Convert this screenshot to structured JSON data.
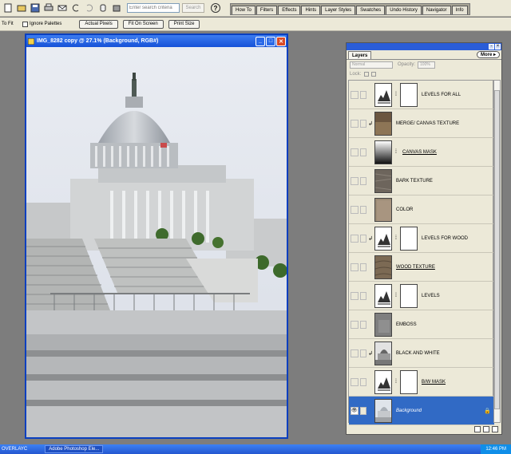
{
  "toolbar": {
    "search_placeholder": "Enter search criteria",
    "search_button": "Search",
    "help": "?"
  },
  "palette_well": {
    "tabs": [
      "How To",
      "Filters",
      "Effects",
      "Hints",
      "Layer Styles",
      "Swatches",
      "Undo History",
      "Navigator",
      "Info"
    ]
  },
  "options_bar": {
    "to_fit": "To Fit",
    "ignore_palettes": "Ignore Palettes",
    "actual_pixels": "Actual Pixels",
    "fit_on_screen": "Fit On Screen",
    "print_size": "Print Size"
  },
  "document": {
    "title": "IMG_8282 copy @ 27.1% (Background, RGB#)"
  },
  "layers_panel": {
    "tab_label": "Layers",
    "more_label": "More",
    "blend_mode": "Normal",
    "opacity_label": "Opacity:",
    "opacity_value": "100%",
    "lock_label": "Lock:",
    "layers": [
      {
        "name": "LEVELS FOR ALL",
        "type": "adjustment",
        "clipped": false,
        "underline": false,
        "selected": false
      },
      {
        "name": "MERGE/ CANVAS TEXTURE",
        "type": "image",
        "clipped": true,
        "underline": false,
        "selected": false
      },
      {
        "name": "CANVAS MASK",
        "type": "gradient-mask",
        "clipped": false,
        "underline": true,
        "selected": false
      },
      {
        "name": "BARK TEXTURE",
        "type": "texture",
        "clipped": false,
        "underline": false,
        "selected": false
      },
      {
        "name": "COLOR",
        "type": "color",
        "clipped": false,
        "underline": false,
        "selected": false
      },
      {
        "name": "LEVELS FOR WOOD",
        "type": "adjustment",
        "clipped": true,
        "underline": false,
        "selected": false
      },
      {
        "name": "WOOD TEXTURE",
        "type": "wood",
        "clipped": false,
        "underline": true,
        "selected": false
      },
      {
        "name": "LEVELS",
        "type": "adjustment",
        "clipped": false,
        "underline": false,
        "selected": false
      },
      {
        "name": "EMBOSS",
        "type": "emboss",
        "clipped": false,
        "underline": false,
        "selected": false
      },
      {
        "name": "BLACK AND WHITE",
        "type": "bw-photo",
        "clipped": true,
        "underline": false,
        "selected": false
      },
      {
        "name": "B/W MASK",
        "type": "adjustment",
        "clipped": false,
        "underline": true,
        "selected": false
      },
      {
        "name": "Background",
        "type": "photo",
        "clipped": false,
        "underline": false,
        "selected": true
      }
    ]
  },
  "taskbar": {
    "start_label": "OVERLAYC",
    "app_item": "Adobe Photoshop Ele...",
    "clock": "12:46 PM"
  },
  "colors": {
    "window_border": "#0a3fbf",
    "titlebar": "#1652d8",
    "selected_layer": "#316ac5",
    "workspace": "#7d7d7d"
  }
}
